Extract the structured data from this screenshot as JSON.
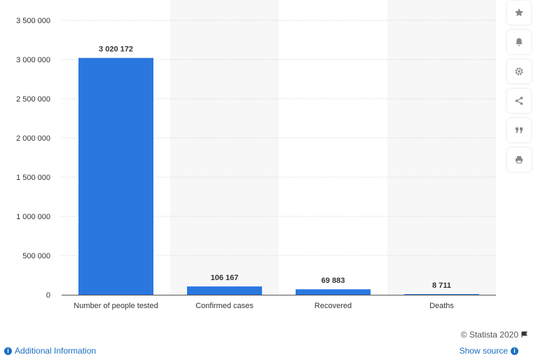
{
  "chart_data": {
    "type": "bar",
    "categories": [
      "Number of people tested",
      "Confirmed cases",
      "Recovered",
      "Deaths"
    ],
    "values": [
      3020172,
      106167,
      69883,
      8711
    ],
    "data_labels": [
      "3 020 172",
      "106 167",
      "69 883",
      "8 711"
    ],
    "ylim": [
      0,
      3500000
    ],
    "yticks": [
      0,
      500000,
      1000000,
      1500000,
      2000000,
      2500000,
      3000000,
      3500000
    ],
    "ytick_labels": [
      "0",
      "500 000",
      "1 000 000",
      "1 500 000",
      "2 000 000",
      "2 500 000",
      "3 000 000",
      "3 500 000"
    ],
    "grid": true,
    "bar_color": "#2a77e0"
  },
  "footer": {
    "copyright": "© Statista 2020",
    "additional_info": "Additional Information",
    "show_source": "Show source"
  },
  "toolbar": {
    "icons": [
      "star-icon",
      "bell-icon",
      "gear-icon",
      "share-icon",
      "quote-icon",
      "print-icon"
    ]
  }
}
